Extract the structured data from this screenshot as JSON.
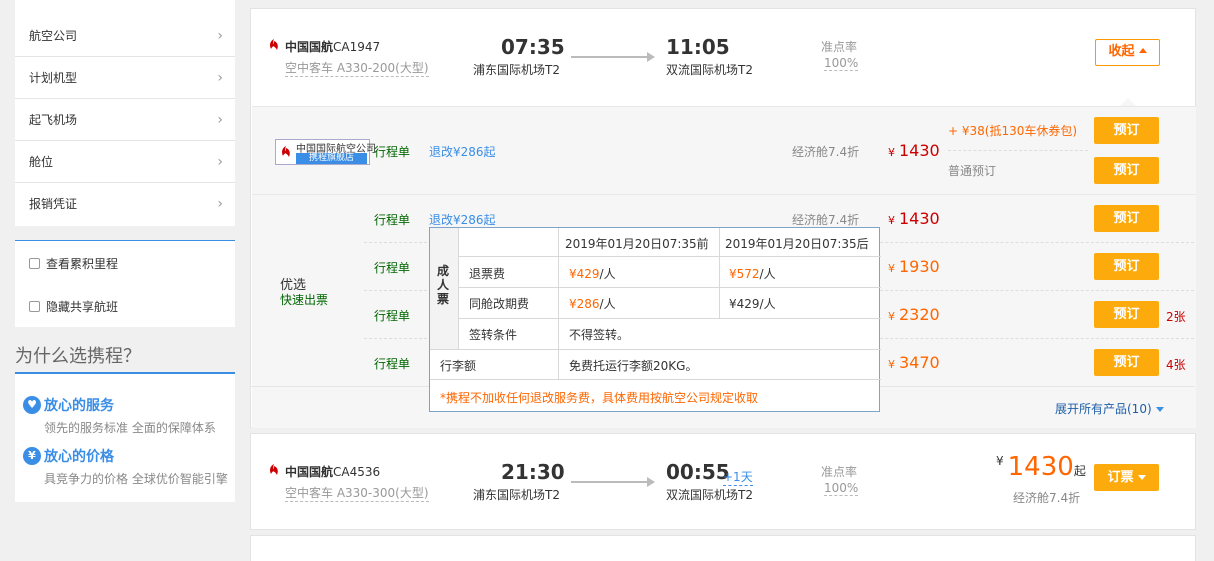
{
  "sidebar": {
    "filters": [
      {
        "label": "航空公司"
      },
      {
        "label": "计划机型"
      },
      {
        "label": "起飞机场"
      },
      {
        "label": "舱位"
      },
      {
        "label": "报销凭证"
      }
    ],
    "checkboxes": [
      {
        "label": "查看累积里程"
      },
      {
        "label": "隐藏共享航班"
      }
    ],
    "why_title": "为什么选携程？",
    "why_items": [
      {
        "title": "放心的服务",
        "desc": "领先的服务标准 全面的保障体系",
        "icon": "heart-icon"
      },
      {
        "title": "放心的价格",
        "desc": "具竞争力的价格 全球优价智能引擎",
        "icon": "yen-icon"
      }
    ]
  },
  "flight1": {
    "airline": "中国国航",
    "flight_no": "CA1947",
    "model": "空中客车 A330-200(大型)",
    "dep_time": "07:35",
    "dep_airport": "浦东国际机场T2",
    "arr_time": "11:05",
    "arr_airport": "双流国际机场T2",
    "ontime_label": "准点率",
    "ontime_value": "100%",
    "collapse_label": "收起"
  },
  "flagship": {
    "logo_text": "中国国际航空公司",
    "logo_sub": "携程旗舰店",
    "itinerary": "行程单",
    "change": "退改¥286起",
    "cabin": "经济舱7.4折",
    "currency": "¥",
    "price": "1430",
    "promo": "+ ¥38(抵130车休券包)",
    "normal": "普通预订",
    "book": "预订"
  },
  "fast": {
    "label": "优选",
    "sub": "快速出票",
    "rows": [
      {
        "itinerary": "行程单",
        "change": "退改¥286起",
        "cabin": "经济舱7.4折",
        "price": "1430",
        "left": ""
      },
      {
        "itinerary": "行程单",
        "change": "",
        "cabin": "",
        "price": "1930",
        "left": ""
      },
      {
        "itinerary": "行程单",
        "change": "",
        "cabin": "",
        "price": "2320",
        "left": "2张"
      },
      {
        "itinerary": "行程单",
        "change": "",
        "cabin": "",
        "price": "3470",
        "left": "4张"
      }
    ],
    "book": "预订",
    "currency": "¥",
    "expand": "展开所有产品(10)"
  },
  "popover": {
    "head_before": "2019年01月20日07:35前",
    "head_after": "2019年01月20日07:35后",
    "side_label": "成人票",
    "refund_label": "退票费",
    "refund_before_amount": "¥429",
    "refund_before_unit": "/人",
    "refund_after_amount": "¥572",
    "refund_after_unit": "/人",
    "change_label": "同舱改期费",
    "change_before_amount": "¥286",
    "change_before_unit": "/人",
    "change_after_amount": "¥429",
    "change_after_unit": "/人",
    "transfer_label": "签转条件",
    "transfer_value": "不得签转。",
    "baggage_label": "行李额",
    "baggage_value": "免费托运行李额20KG。",
    "note": "*携程不加收任何退改服务费，具体费用按航空公司规定收取"
  },
  "flight2": {
    "airline": "中国国航",
    "flight_no": "CA4536",
    "model": "空中客车 A330-300(大型)",
    "dep_time": "21:30",
    "dep_airport": "浦东国际机场T2",
    "arr_time": "00:55",
    "arr_plus": "+1天",
    "arr_airport": "双流国际机场T2",
    "ontime_label": "准点率",
    "ontime_value": "100%",
    "currency": "¥",
    "price": "1430",
    "price_suffix": "起",
    "cabin": "经济舱7.4折",
    "book_label": "订票"
  },
  "colors": {
    "accent": "#fdab0c",
    "blue": "#3a8ee6",
    "price": "#f60",
    "dark_price": "#c00"
  }
}
